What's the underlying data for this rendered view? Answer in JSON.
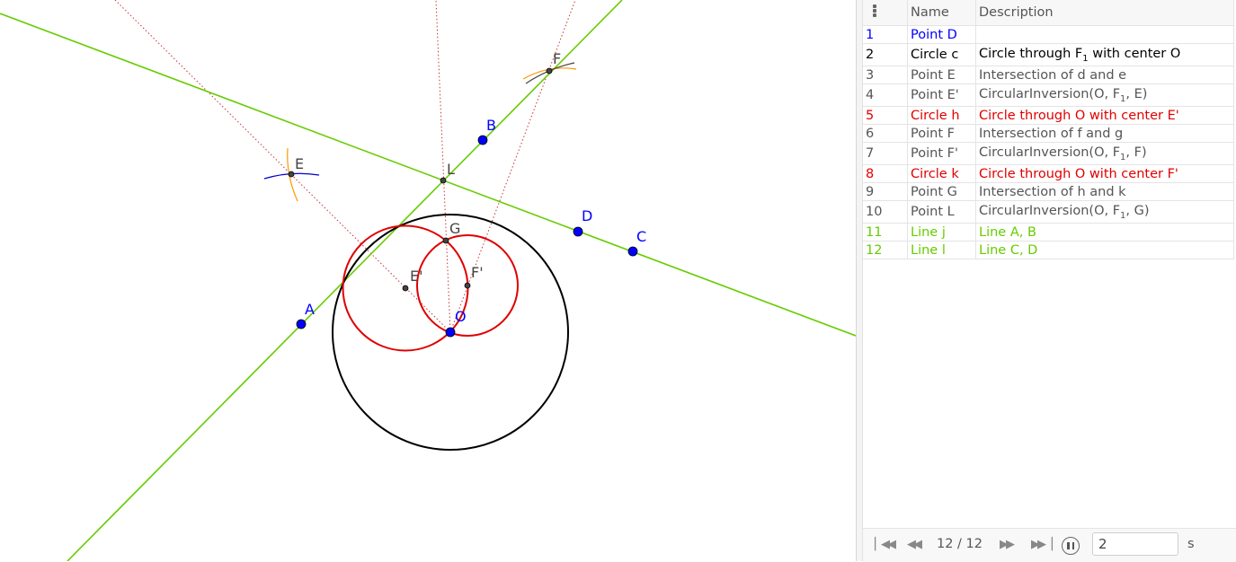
{
  "colors": {
    "line": "#66cc00",
    "free_point": "#0000ff",
    "point": "#444444",
    "circle_c": "#000000",
    "red_circle": "#e00000",
    "construction": "#cc3333",
    "arc_orange": "#ff9900",
    "arc_blue": "#0000cc",
    "row_blue": "#0000ff",
    "row_red": "#e00000",
    "row_green": "#66cc00",
    "row_gray": "#555555",
    "row_black": "#000000"
  },
  "graphics": {
    "labels": {
      "A": "A",
      "B": "B",
      "C": "C",
      "D": "D",
      "E": "E",
      "E_prime": "E'",
      "F": "F",
      "F_prime": "F'",
      "G": "G",
      "L": "L",
      "O": "O"
    }
  },
  "protocol": {
    "headers": {
      "name": "Name",
      "description": "Description"
    },
    "rows": [
      {
        "num": "1",
        "name": "Point D",
        "desc": "",
        "color": "blue"
      },
      {
        "num": "2",
        "name": "Circle c",
        "desc": "Circle through F₁ with center O",
        "color": "black"
      },
      {
        "num": "3",
        "name": "Point E",
        "desc": "Intersection of d and e",
        "color": "gray"
      },
      {
        "num": "4",
        "name": "Point E'",
        "desc": "CircularInversion(O, F₁, E)",
        "color": "gray"
      },
      {
        "num": "5",
        "name": "Circle h",
        "desc": "Circle through O with center E'",
        "color": "red"
      },
      {
        "num": "6",
        "name": "Point F",
        "desc": "Intersection of f and g",
        "color": "gray"
      },
      {
        "num": "7",
        "name": "Point F'",
        "desc": "CircularInversion(O, F₁, F)",
        "color": "gray"
      },
      {
        "num": "8",
        "name": "Circle k",
        "desc": "Circle through O with center F'",
        "color": "red"
      },
      {
        "num": "9",
        "name": "Point G",
        "desc": "Intersection of h and k",
        "color": "gray"
      },
      {
        "num": "10",
        "name": "Point L",
        "desc": "CircularInversion(O, F₁, G)",
        "color": "gray"
      },
      {
        "num": "11",
        "name": "Line j",
        "desc": "Line A, B",
        "color": "green"
      },
      {
        "num": "12",
        "name": "Line l",
        "desc": "Line C, D",
        "color": "green"
      }
    ]
  },
  "navigation": {
    "step_text": "12 / 12",
    "speed_value": "2",
    "speed_unit": "s",
    "icons": {
      "first": "skip-to-start-icon",
      "previous": "rewind-icon",
      "next": "fast-forward-icon",
      "last": "skip-to-end-icon",
      "pause": "pause-icon",
      "drag": "drag-handle-icon"
    }
  }
}
